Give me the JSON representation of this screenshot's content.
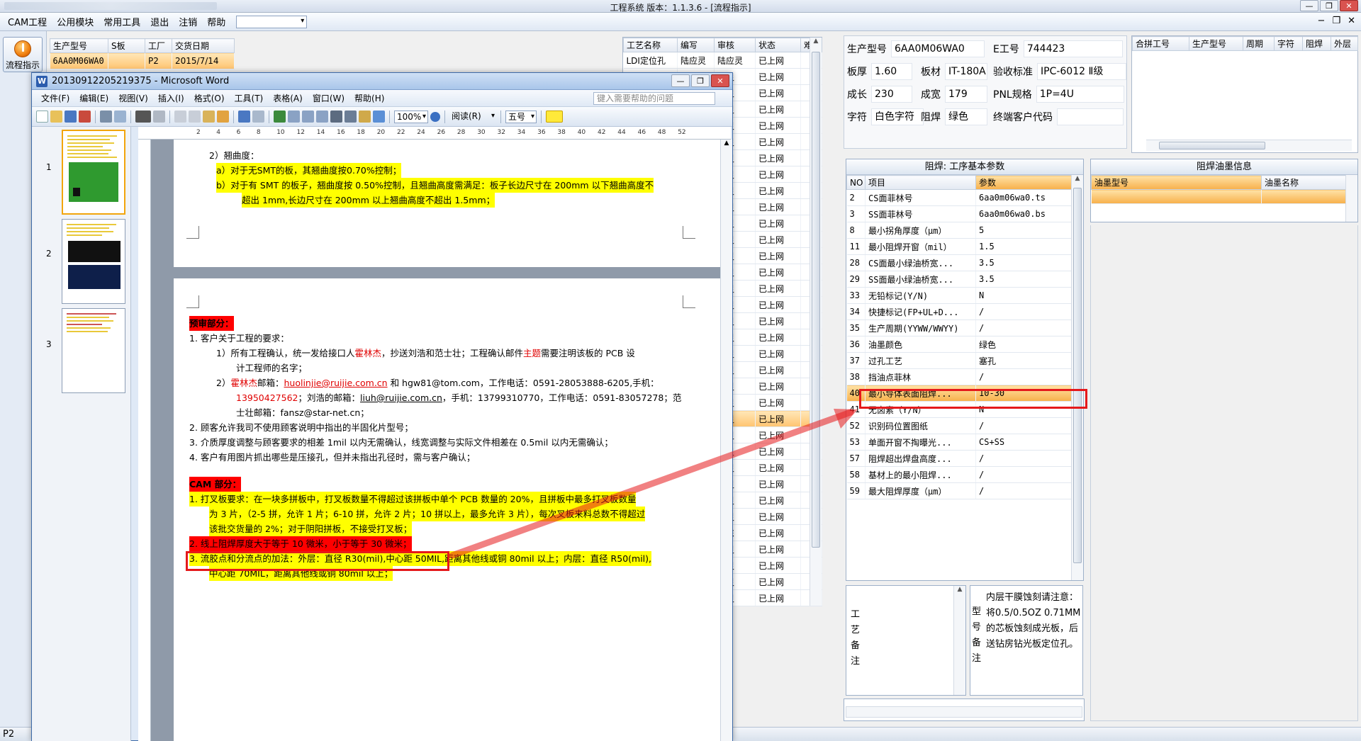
{
  "app": {
    "title": "工程系统  版本：1.1.3.6 - [流程指示]"
  },
  "menu": [
    "CAM工程",
    "公用模块",
    "常用工具",
    "退出",
    "注销",
    "帮助"
  ],
  "sidebar": {
    "flow_label": "流程指示"
  },
  "prod_table": {
    "headers": [
      "生产型号",
      "S板",
      "工厂",
      "交货日期"
    ],
    "rows": [
      [
        "6AA0M06WA0",
        "",
        "P2",
        "2015/7/14"
      ]
    ]
  },
  "process_table": {
    "headers": [
      "工艺名称",
      "编写",
      "审核",
      "状态",
      "难度"
    ],
    "rows": [
      [
        "LDI定位孔",
        "陆应灵",
        "陆应灵",
        "已上网",
        ""
      ],
      [
        "",
        "",
        "应灵",
        "已上网",
        ""
      ],
      [
        "",
        "",
        "应灵",
        "已上网",
        ""
      ],
      [
        "",
        "",
        "应灵",
        "已上网",
        ""
      ],
      [
        "",
        "",
        "应灵",
        "已上网",
        ""
      ],
      [
        "",
        "",
        "应灵",
        "已上网",
        ""
      ],
      [
        "",
        "",
        "应灵",
        "已上网",
        ""
      ],
      [
        "",
        "",
        "应灵",
        "已上网",
        ""
      ],
      [
        "",
        "",
        "应灵",
        "已上网",
        ""
      ],
      [
        "",
        "",
        "应灵",
        "已上网",
        ""
      ],
      [
        "",
        "",
        "应灵",
        "已上网",
        ""
      ],
      [
        "",
        "",
        "应灵",
        "已上网",
        ""
      ],
      [
        "",
        "",
        "应灵",
        "已上网",
        ""
      ],
      [
        "",
        "",
        "应灵",
        "已上网",
        ""
      ],
      [
        "",
        "",
        "应灵",
        "已上网",
        ""
      ],
      [
        "",
        "",
        "应灵",
        "已上网",
        ""
      ],
      [
        "",
        "",
        "应灵",
        "已上网",
        ""
      ],
      [
        "",
        "",
        "应灵",
        "已上网",
        ""
      ],
      [
        "",
        "",
        "应灵",
        "已上网",
        ""
      ],
      [
        "",
        "",
        "应灵",
        "已上网",
        ""
      ],
      [
        "",
        "",
        "应灵",
        "已上网",
        ""
      ],
      [
        "",
        "",
        "应灵",
        "已上网",
        ""
      ],
      [
        "",
        "",
        "应灵",
        "已上网",
        ""
      ],
      [
        "",
        "",
        "应灵",
        "已上网",
        ""
      ],
      [
        "",
        "",
        "应灵",
        "已上网",
        ""
      ],
      [
        "",
        "",
        "应灵",
        "已上网",
        ""
      ],
      [
        "",
        "",
        "应灵",
        "已上网",
        ""
      ],
      [
        "",
        "",
        "应灵",
        "已上网",
        ""
      ],
      [
        "",
        "",
        "应灵",
        "已上网",
        ""
      ],
      [
        "",
        "",
        "志东",
        "已上网",
        ""
      ],
      [
        "",
        "",
        "应灵",
        "已上网",
        ""
      ],
      [
        "",
        "",
        "应灵",
        "已上网",
        ""
      ],
      [
        "",
        "",
        "应灵",
        "已上网",
        ""
      ],
      [
        "",
        "",
        "应灵",
        "已上网",
        ""
      ]
    ]
  },
  "info": {
    "model_label": "生产型号",
    "model": "6AA0M06WA0",
    "e_label": "E工号",
    "e": "744423",
    "thick_label": "板厚",
    "thick": "1.60",
    "mat_label": "板材",
    "mat": "IT-180A",
    "std_label": "验收标准",
    "std": "IPC-6012 Ⅱ级",
    "len_label": "成长",
    "len": "230",
    "wid_label": "成宽",
    "wid": "179",
    "pnl_label": "PNL规格",
    "pnl": "1P=4U",
    "char_label": "字符",
    "char": "白色字符",
    "mask_label": "阻焊",
    "mask": "绿色",
    "cust_label": "终端客户代码",
    "cust": ""
  },
  "combine": {
    "headers": [
      "合拼工号",
      "生产型号",
      "周期",
      "字符",
      "阻焊",
      "外层"
    ]
  },
  "params": {
    "title": "阻焊: 工序基本参数",
    "headers": [
      "NO",
      "项目",
      "参数"
    ],
    "rows": [
      [
        "2",
        "CS面菲林号",
        "6aa0m06wa0.ts"
      ],
      [
        "3",
        "SS面菲林号",
        "6aa0m06wa0.bs"
      ],
      [
        "8",
        "最小拐角厚度（μm）",
        "5"
      ],
      [
        "11",
        "最小阻焊开窗（mil）",
        "1.5"
      ],
      [
        "28",
        "CS面最小绿油桥宽...",
        "3.5"
      ],
      [
        "29",
        "SS面最小绿油桥宽...",
        "3.5"
      ],
      [
        "33",
        "无铅标记(Y/N)",
        "N"
      ],
      [
        "34",
        "快捷标记(FP+UL+D...",
        "/"
      ],
      [
        "35",
        "生产周期(YYWW/WWYY)",
        "/"
      ],
      [
        "36",
        "油墨颜色",
        "绿色"
      ],
      [
        "37",
        "过孔工艺",
        "塞孔"
      ],
      [
        "38",
        "挡油点菲林",
        "/"
      ],
      [
        "40",
        "最小导体表面阻焊...",
        "10-30"
      ],
      [
        "41",
        "无卤素（Y/N）",
        "N"
      ],
      [
        "52",
        "识别码位置图纸",
        "/"
      ],
      [
        "53",
        "单面开窗不掏曝光...",
        "CS+SS"
      ],
      [
        "57",
        "阻焊超出焊盘高度...",
        "/"
      ],
      [
        "58",
        "基材上的最小阻焊...",
        "/"
      ],
      [
        "59",
        "最大阻焊厚度（μm）",
        "/"
      ]
    ]
  },
  "ink": {
    "title": "阻焊油墨信息",
    "headers": [
      "油墨型号",
      "油墨名称"
    ]
  },
  "remark1": {
    "label": "工艺备注"
  },
  "remark2": {
    "label": "型号备注",
    "text": "内层干膜蚀刻请注意：将0.5/0.5OZ 0.71MM的芯板蚀刻成光板，后送钻房钻光板定位孔。"
  },
  "status": {
    "page": "P2"
  },
  "word": {
    "title": "20130912205219375 - Microsoft Word",
    "menu": [
      "文件(F)",
      "编辑(E)",
      "视图(V)",
      "插入(I)",
      "格式(O)",
      "工具(T)",
      "表格(A)",
      "窗口(W)",
      "帮助(H)"
    ],
    "help_placeholder": "键入需要帮助的问题",
    "zoom": "100%",
    "read": "阅读(R)",
    "font_size": "五号",
    "thumb_nums": [
      "1",
      "2",
      "3"
    ],
    "ruler": [
      "2",
      "4",
      "6",
      "8",
      "10",
      "12",
      "14",
      "16",
      "18",
      "20",
      "22",
      "24",
      "26",
      "28",
      "30",
      "32",
      "34",
      "36",
      "38",
      "40",
      "42",
      "44",
      "46",
      "48",
      "52"
    ],
    "doc": {
      "l1": "2）翘曲度：",
      "l2": "a）对于无SMT的板，其翘曲度按0.70%控制；",
      "l3": "b）对于有 SMT 的板子，翘曲度按 0.50%控制，且翘曲高度需满足：板子长边尺寸在 200mm 以下翘曲高度不",
      "l4": "超出 1mm,长边尺寸在 200mm 以上翘曲高度不超出 1.5mm；",
      "h1": "预审部分：",
      "p1": "1.  客户关于工程的要求：",
      "p2a": "1）所有工程确认，统一发给接口人",
      "p2b": "霍林杰",
      "p2c": "，抄送刘浩和范士壮；工程确认邮件",
      "p2d": "主题",
      "p2e": "需要注明该板的 PCB 设",
      "p3": "计工程师的名字；",
      "p4a": "2）",
      "p4b": "霍林杰",
      "p4c": "邮箱：",
      "p4d": "huolinjie@ruijie.com.cn",
      "p4e": " 和 hgw81@tom.com，工作电话：0591-28053888-6205,手机：",
      "p5a": "13950427562",
      "p5b": "；刘浩的邮箱：",
      "p5c": "liuh@ruijie.com.cn",
      "p5d": "，手机：13799310770，工作电话：0591-83057278；范",
      "p6": "士壮邮箱：fansz@star-net.cn；",
      "p7": "2.  顾客允许我司不使用顾客说明中指出的半固化片型号；",
      "p8": "3.  介质厚度调整与顾客要求的相差 1mil 以内无需确认，线宽调整与实际文件相差在 0.5mil 以内无需确认；",
      "p9": "4.  客户有用图片抓出哪些是压接孔，但并未指出孔径时，需与客户确认；",
      "h2": "CAM 部分：",
      "c1": "1.  打叉板要求：在一块多拼板中，打叉板数量不得超过该拼板中单个 PCB 数量的 20%，且拼板中最多打叉板数量",
      "c2": "为 3 片，（2-5 拼，允许 1 片；6-10 拼，允许 2 片；10 拼以上，最多允许 3 片），每次叉板来料总数不得超过",
      "c3": "该批交货量的 2%；对于阴阳拼板，不接受打叉板；",
      "c4": "2.  线上阻焊厚度大于等于 10 微米，小于等于 30 微米；",
      "c5": "3.  流胶点和分流点的加法：外层：直径 R30(mil),中心距 50MIL,距离其他线或铜 80mil 以上；内层：直径 R50(mil),",
      "c6": "中心距 70MIL，距离其他线或铜 80mil 以上；"
    }
  },
  "colors": {
    "highlight": "#ffff00",
    "annotation": "#e5191b",
    "selection": "#ffc470"
  }
}
